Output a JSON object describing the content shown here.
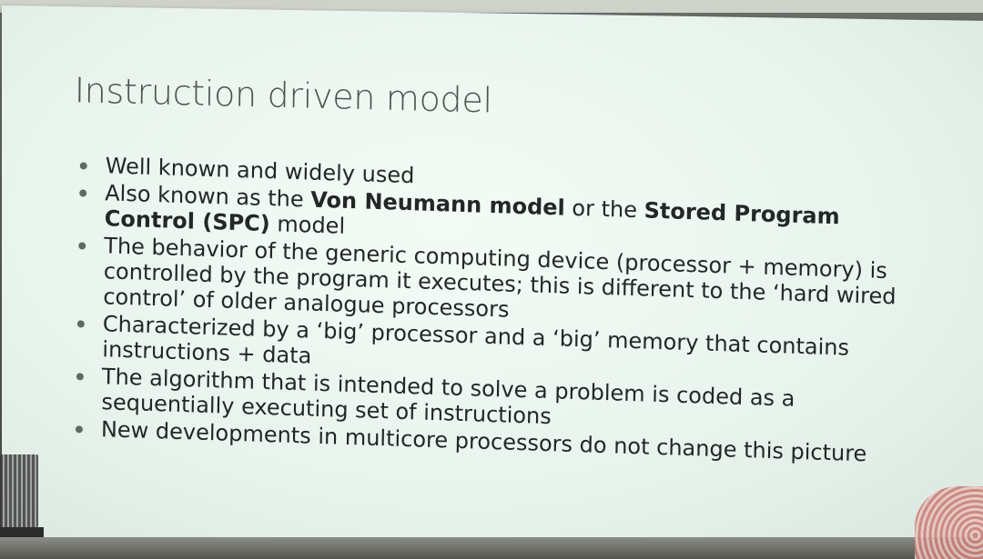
{
  "slide": {
    "title": "Instruction driven model",
    "bullets": [
      {
        "text": "Well known and widely used"
      },
      {
        "parts": [
          {
            "text": "Also known as the ",
            "bold": false
          },
          {
            "text": "Von Neumann model",
            "bold": true
          },
          {
            "text": " or the ",
            "bold": false
          },
          {
            "text": "Stored Program Control (SPC)",
            "bold": true
          },
          {
            "text": " model",
            "bold": false
          }
        ]
      },
      {
        "text": "The behavior of the generic computing device (processor + memory) is controlled by the program it executes; this is different to the ‘hard wired control’ of older analogue processors"
      },
      {
        "text": "Characterized by a ‘big’ processor and a ‘big’ memory that contains instructions + data"
      },
      {
        "text": "The algorithm that is intended to solve a problem is coded as a sequentially executing set of instructions"
      },
      {
        "text": "New developments in multicore processors do not change this picture"
      }
    ]
  },
  "colors": {
    "slide_background": "#eaf5ef",
    "title_text": "#4d534f",
    "body_text": "#232725",
    "bullet_dot": "#5e6b64"
  }
}
